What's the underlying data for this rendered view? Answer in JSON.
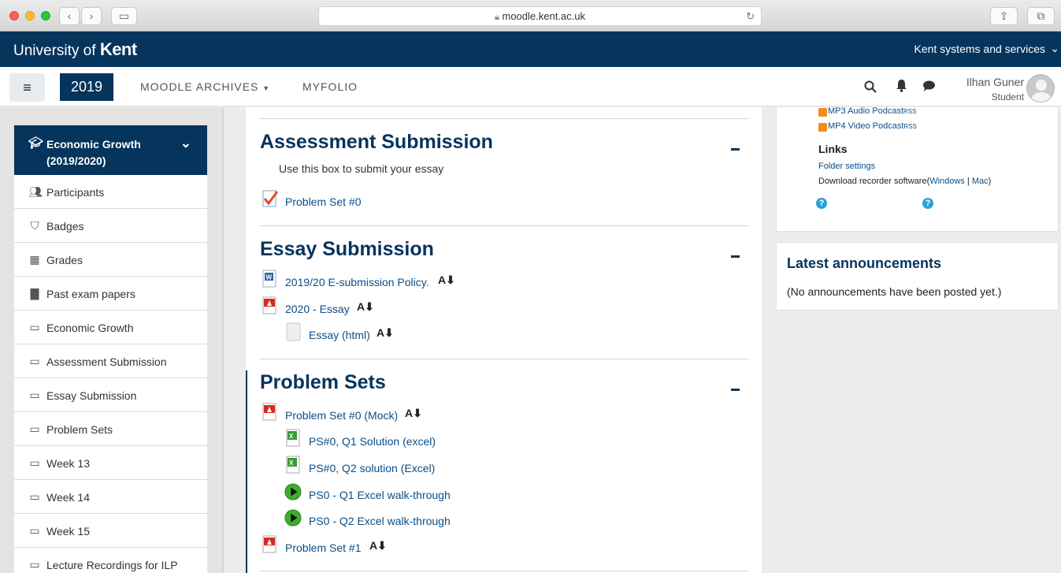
{
  "browser": {
    "url": "moodle.kent.ac.uk"
  },
  "kent_bar": {
    "brand_prefix": "University of ",
    "brand_name": "Kent",
    "systems": "Kent systems and services"
  },
  "nav": {
    "year": "2019",
    "links": [
      "MOODLE ARCHIVES",
      "MYFOLIO"
    ],
    "user_name": "Ilhan Guner",
    "user_role": "Student"
  },
  "course": {
    "title_line1": "Economic Growth",
    "title_line2": "(2019/2020)"
  },
  "drawer_items": [
    {
      "label": "Participants",
      "icon": "users-icon"
    },
    {
      "label": "Badges",
      "icon": "shield-icon"
    },
    {
      "label": "Grades",
      "icon": "table-icon"
    },
    {
      "label": "Past exam papers",
      "icon": "file-icon"
    },
    {
      "label": "Economic Growth",
      "icon": "folder-icon"
    },
    {
      "label": "Assessment Submission",
      "icon": "folder-icon"
    },
    {
      "label": "Essay Submission",
      "icon": "folder-icon"
    },
    {
      "label": "Problem Sets",
      "icon": "folder-icon"
    },
    {
      "label": "Week 13",
      "icon": "folder-icon"
    },
    {
      "label": "Week 14",
      "icon": "folder-icon"
    },
    {
      "label": "Week 15",
      "icon": "folder-icon"
    },
    {
      "label": "Lecture Recordings for ILP",
      "icon": "folder-icon"
    }
  ],
  "sections": {
    "assessment": {
      "title": "Assessment Submission",
      "summary": "Use this box to submit your essay",
      "activities": [
        "Problem Set #0"
      ]
    },
    "essay": {
      "title": "Essay Submission",
      "activities": [
        "2019/20 E-submission Policy.",
        "2020 - Essay",
        "Essay (html)"
      ]
    },
    "problem_sets": {
      "title": "Problem Sets",
      "activities": [
        "Problem Set #0 (Mock)",
        "PS#0, Q1 Solution (excel)",
        "PS#0, Q2 solution (Excel)",
        "PS0 - Q1 Excel walk-through",
        "PS0 - Q2 Excel walk-through",
        "Problem Set #1"
      ]
    }
  },
  "right": {
    "podcast_audio": "MP3 Audio Podcast",
    "podcast_video": "MP4 Video Podcast",
    "rss": "RSS",
    "links_heading": "Links",
    "folder_settings": "Folder settings",
    "download_text": "Download recorder software(",
    "windows": "Windows",
    "separator": " | ",
    "mac": "Mac",
    "close_paren": ")",
    "announcements_title": "Latest announcements",
    "announcements_empty": "(No announcements have been posted yet.)"
  },
  "colors": {
    "brand": "#05345c",
    "link": "#0b4e87"
  }
}
